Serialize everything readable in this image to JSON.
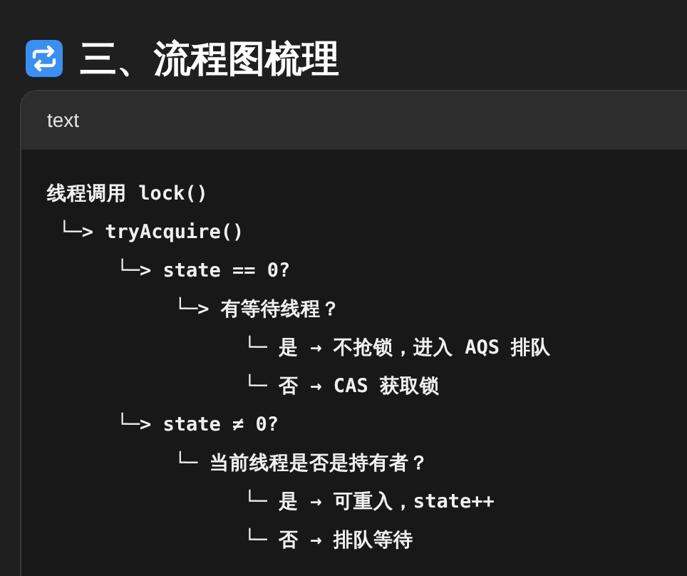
{
  "heading": {
    "title": "三、流程图梳理"
  },
  "code_block": {
    "language": "text",
    "lines": [
      "线程调用 lock()",
      " └─> tryAcquire()",
      "      └─> state == 0?",
      "           └─> 有等待线程？",
      "                 └─ 是 → 不抢锁，进入 AQS 排队",
      "                 └─ 否 → CAS 获取锁",
      "      └─> state ≠ 0?",
      "           └─ 当前线程是否是持有者？",
      "                 └─ 是 → 可重入，state++",
      "                 └─ 否 → 排队等待"
    ]
  }
}
